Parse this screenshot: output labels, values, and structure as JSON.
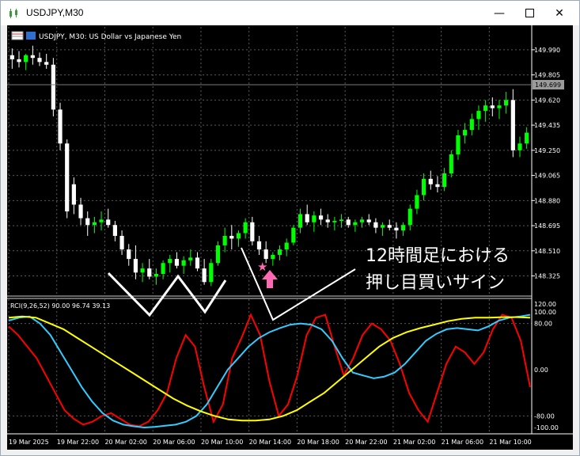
{
  "window": {
    "title": "USDJPY,M30"
  },
  "chart_header": {
    "label": "USDJPY, M30:  US Dollar vs Japanese Yen"
  },
  "rci_label": "RCI(9,26,52) 90.00 96.74 39.13",
  "annotation": {
    "line1": "12時間足における",
    "line2": "押し目買いサイン"
  },
  "current_price": "149.699",
  "colors": {
    "bull": "#00ff00",
    "bear": "#ffffff",
    "rci_short": "#ff0000",
    "rci_mid": "#33ccff",
    "rci_long": "#ffff00",
    "grid": "#5a5a5a",
    "arrow": "#ff69b4"
  },
  "chart_data": [
    {
      "type": "candlestick",
      "ylim": [
        148.2,
        150.1
      ],
      "y_ticks": [
        "149.990",
        "149.805",
        "149.620",
        "149.435",
        "149.250",
        "149.065",
        "148.880",
        "148.695",
        "148.510",
        "148.325"
      ],
      "x_ticks": [
        "19 Mar 2025",
        "19 Mar 22:00",
        "20 Mar 02:00",
        "20 Mar 06:00",
        "20 Mar 10:00",
        "20 Mar 14:00",
        "20 Mar 18:00",
        "20 Mar 22:00",
        "21 Mar 02:00",
        "21 Mar 06:00",
        "21 Mar 10:00"
      ],
      "candles": [
        [
          149.95,
          150.0,
          149.85,
          149.92
        ],
        [
          149.92,
          149.98,
          149.86,
          149.9
        ],
        [
          149.9,
          149.96,
          149.84,
          149.95
        ],
        [
          149.95,
          150.02,
          149.88,
          149.93
        ],
        [
          149.93,
          149.97,
          149.87,
          149.9
        ],
        [
          149.9,
          149.96,
          149.85,
          149.88
        ],
        [
          149.88,
          149.93,
          149.5,
          149.55
        ],
        [
          149.55,
          149.6,
          149.25,
          149.3
        ],
        [
          149.3,
          149.33,
          148.75,
          148.8
        ],
        [
          149.0,
          149.05,
          148.78,
          148.85
        ],
        [
          148.85,
          148.9,
          148.7,
          148.75
        ],
        [
          148.75,
          148.8,
          148.62,
          148.7
        ],
        [
          148.7,
          148.76,
          148.64,
          148.72
        ],
        [
          148.72,
          148.8,
          148.66,
          148.74
        ],
        [
          148.74,
          148.82,
          148.68,
          148.7
        ],
        [
          148.7,
          148.73,
          148.58,
          148.62
        ],
        [
          148.62,
          148.66,
          148.48,
          148.52
        ],
        [
          148.52,
          148.56,
          148.4,
          148.45
        ],
        [
          148.45,
          148.55,
          148.3,
          148.35
        ],
        [
          148.35,
          148.42,
          148.28,
          148.38
        ],
        [
          148.38,
          148.45,
          148.3,
          148.32
        ],
        [
          148.32,
          148.38,
          148.26,
          148.34
        ],
        [
          148.34,
          148.44,
          148.3,
          148.42
        ],
        [
          148.42,
          148.48,
          148.35,
          148.45
        ],
        [
          148.45,
          148.5,
          148.38,
          148.4
        ],
        [
          148.4,
          148.47,
          148.34,
          148.44
        ],
        [
          148.44,
          148.52,
          148.4,
          148.46
        ],
        [
          148.46,
          148.5,
          148.36,
          148.38
        ],
        [
          148.38,
          148.45,
          148.26,
          148.28
        ],
        [
          148.28,
          148.45,
          148.25,
          148.42
        ],
        [
          148.42,
          148.58,
          148.4,
          148.55
        ],
        [
          148.55,
          148.68,
          148.5,
          148.62
        ],
        [
          148.62,
          148.7,
          148.52,
          148.6
        ],
        [
          148.6,
          148.66,
          148.54,
          148.64
        ],
        [
          148.64,
          148.75,
          148.6,
          148.72
        ],
        [
          148.72,
          148.76,
          148.55,
          148.58
        ],
        [
          148.58,
          148.62,
          148.48,
          148.52
        ],
        [
          148.52,
          148.58,
          148.42,
          148.45
        ],
        [
          148.45,
          148.5,
          148.4,
          148.48
        ],
        [
          148.48,
          148.55,
          148.44,
          148.52
        ],
        [
          148.52,
          148.6,
          148.47,
          148.57
        ],
        [
          148.57,
          148.7,
          148.55,
          148.68
        ],
        [
          148.68,
          148.82,
          148.64,
          148.78
        ],
        [
          148.78,
          148.85,
          148.7,
          148.72
        ],
        [
          148.72,
          148.8,
          148.65,
          148.77
        ],
        [
          148.77,
          148.82,
          148.7,
          148.74
        ],
        [
          148.74,
          148.78,
          148.68,
          148.72
        ],
        [
          148.72,
          148.76,
          148.66,
          148.73
        ],
        [
          148.73,
          148.78,
          148.68,
          148.74
        ],
        [
          148.74,
          148.76,
          148.68,
          148.7
        ],
        [
          148.7,
          148.74,
          148.65,
          148.72
        ],
        [
          148.72,
          148.76,
          148.68,
          148.74
        ],
        [
          148.74,
          148.78,
          148.7,
          148.72
        ],
        [
          148.72,
          148.75,
          148.64,
          148.68
        ],
        [
          148.68,
          148.72,
          148.62,
          148.7
        ],
        [
          148.7,
          148.74,
          148.66,
          148.68
        ],
        [
          148.68,
          148.72,
          148.6,
          148.66
        ],
        [
          148.66,
          148.72,
          148.62,
          148.7
        ],
        [
          148.7,
          148.85,
          148.66,
          148.82
        ],
        [
          148.82,
          148.96,
          148.78,
          148.92
        ],
        [
          148.92,
          149.08,
          148.88,
          149.04
        ],
        [
          149.04,
          149.1,
          148.96,
          149.0
        ],
        [
          149.0,
          149.06,
          148.94,
          148.98
        ],
        [
          148.98,
          149.12,
          148.95,
          149.08
        ],
        [
          149.08,
          149.25,
          149.05,
          149.22
        ],
        [
          149.22,
          149.4,
          149.18,
          149.36
        ],
        [
          149.36,
          149.45,
          149.3,
          149.4
        ],
        [
          149.4,
          149.52,
          149.36,
          149.48
        ],
        [
          149.48,
          149.58,
          149.4,
          149.54
        ],
        [
          149.54,
          149.62,
          149.46,
          149.58
        ],
        [
          149.58,
          149.64,
          149.5,
          149.56
        ],
        [
          149.56,
          149.62,
          149.48,
          149.58
        ],
        [
          149.58,
          149.68,
          149.52,
          149.62
        ],
        [
          149.62,
          149.7,
          149.2,
          149.25
        ],
        [
          149.25,
          149.35,
          149.2,
          149.3
        ],
        [
          149.3,
          149.42,
          149.26,
          149.38
        ]
      ]
    },
    {
      "type": "line",
      "title": "RCI(9,26,52) 90.00 96.74 39.13",
      "ylim": [
        -100,
        100
      ],
      "y_ticks": [
        "120.00",
        "100.00",
        "80.00",
        "0.00",
        "-80.00",
        "-100.00"
      ],
      "series": [
        {
          "values": [
            75,
            60,
            40,
            20,
            -10,
            -40,
            -70,
            -85,
            -95,
            -90,
            -80,
            -75,
            -85,
            -95,
            -98,
            -90,
            -70,
            -40,
            20,
            60,
            40,
            -30,
            -90,
            -60,
            20,
            55,
            95,
            60,
            -20,
            -80,
            -60,
            -10,
            60,
            90,
            95,
            40,
            -10,
            20,
            60,
            80,
            70,
            50,
            10,
            -40,
            -70,
            -90,
            -40,
            10,
            40,
            30,
            10,
            30,
            70,
            95,
            90,
            50,
            -30
          ]
        },
        {
          "values": [
            85,
            90,
            92,
            80,
            60,
            30,
            0,
            -30,
            -55,
            -75,
            -88,
            -95,
            -98,
            -100,
            -99,
            -97,
            -95,
            -90,
            -80,
            -60,
            -30,
            0,
            20,
            40,
            55,
            65,
            72,
            78,
            80,
            78,
            70,
            50,
            20,
            -5,
            -10,
            -15,
            -12,
            -5,
            10,
            30,
            50,
            62,
            70,
            72,
            70,
            68,
            75,
            85,
            90,
            92,
            95
          ]
        },
        {
          "values": [
            90,
            92,
            90,
            80,
            70,
            55,
            40,
            25,
            10,
            -5,
            -20,
            -35,
            -50,
            -62,
            -72,
            -80,
            -86,
            -88,
            -88,
            -86,
            -80,
            -70,
            -55,
            -40,
            -20,
            0,
            20,
            40,
            55,
            65,
            72,
            78,
            84,
            88,
            90,
            90,
            91,
            91,
            90
          ]
        }
      ]
    }
  ]
}
